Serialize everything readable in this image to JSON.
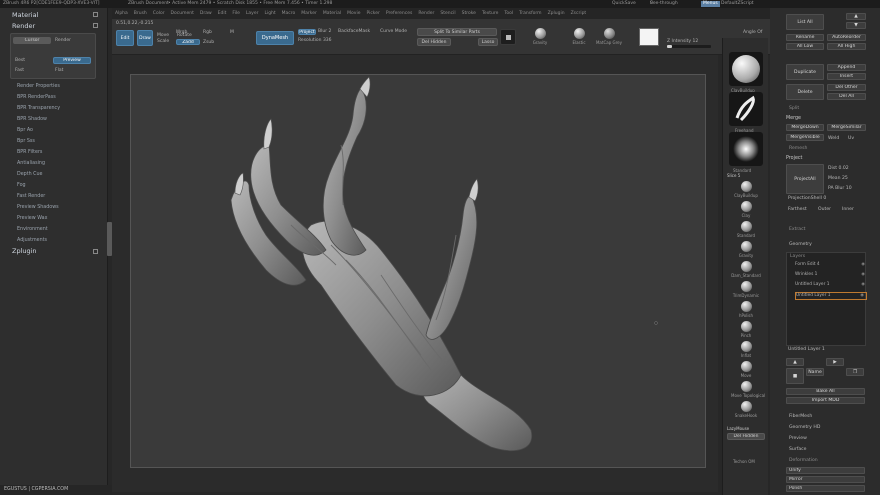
{
  "topbar": {
    "app": "ZBrush 4R6 P2[CDE1FEE9-QDP3-XVE3-VIT]",
    "doc": "ZBrush Document",
    "active_mem": "• Active Mem 2479 • Scratch Disk 1855 • Free Mem 7.456 • Timer 1.298",
    "quicksave": "QuickSave",
    "seethrough": "See-through",
    "seethrough_value": "0",
    "menus": "Menus",
    "script": "DefaultZScript"
  },
  "menus": [
    "Alpha",
    "Brush",
    "Color",
    "Document",
    "Draw",
    "Edit",
    "File",
    "Layer",
    "Light",
    "Macro",
    "Marker",
    "Material",
    "Movie",
    "Picker",
    "Preferences",
    "Render",
    "Stencil",
    "Stroke",
    "Texture",
    "Tool",
    "Transform",
    "Zplugin",
    "Zscript"
  ],
  "shelf": {
    "coords": "0.51,0.22,-0.215",
    "edit": "Edit",
    "draw": "Draw",
    "move": "Move",
    "scale": "Scale",
    "rotate": "Rotate",
    "mrgb": "Mrgb",
    "rgb": "Rgb",
    "m": "M",
    "zadd": "Zadd",
    "zsub": "Zsub",
    "zcut": "Zcut",
    "dynamesh": "DynaMesh",
    "project": "Project",
    "blur": "Blur 2",
    "backface": "BackfaceMask",
    "curve": "Curve Mode",
    "resolution": "Resolution 336",
    "split": "Split To Similar Parts",
    "delhidden": "Del Hidden",
    "lasso": "Lasso",
    "gravity": "Gravity",
    "elastic": "Elastic",
    "matcap": "MatCap Grey",
    "intensity": "Z Intensity 12",
    "intensity_value": 0.12,
    "angle": "Angle Of",
    "colorize": "Colorize"
  },
  "left": {
    "material": "Material",
    "render": "Render",
    "cursor": "Cursor",
    "render_btn": "Render",
    "best": "Best",
    "preview": "Preview",
    "fast": "Fast",
    "flat": "Flat",
    "items": [
      "Render Properties",
      "BPR RenderPass",
      "BPR Transparency",
      "BPR Shadow",
      "Bpr Ao",
      "Bpr Sss",
      "BPR Filters",
      "Antialiasing",
      "Depth Cue",
      "Fog",
      "Fast Render",
      "Preview Shadows",
      "Preview Wax",
      "Environment",
      "Adjustments"
    ],
    "zplugin": "Zplugin"
  },
  "footer": "EGUSTUS | CGPERSIA.COM",
  "tools": {
    "t1": "ClayBuildup",
    "t2": "Freehand",
    "t3": "Standard",
    "s5": "Slice 5",
    "list": [
      "ClayBuildup",
      "Clay",
      "Standard",
      "Gravity",
      "Dam_Standard",
      "TrimDynamic",
      "hPolish",
      "Pinch",
      "Inflat",
      "Move",
      "Move Topological",
      "SnakeHook"
    ],
    "lazymouse": "LazyMouse",
    "delhidden": "Del Hidden",
    "techon": "Techon OM"
  },
  "right": {
    "listall": "List All",
    "rename": "Rename",
    "autoreorder": "AutoReorder",
    "alllow": "All Low",
    "allhigh": "All High",
    "duplicate": "Duplicate",
    "append": "Append",
    "insert": "Insert",
    "delete": "Delete",
    "delother": "Del Other",
    "delall": "Del All",
    "split": "Split",
    "merge": "Merge",
    "mergedown": "MergeDown",
    "mergesimilar": "MergeSimilar",
    "mergevisible": "MergeVisible",
    "weld": "Weld",
    "uv": "Uv",
    "remesh": "Remesh",
    "project": "Project",
    "projectall": "ProjectAll",
    "dist": "Dist 0.02",
    "mean": "Mean 25",
    "pa_blur": "PA Blur 10",
    "projectionshell": "ProjectionShell 0",
    "farthest": "Farthest",
    "outer": "Outer",
    "inner": "Inner",
    "extract": "Extract",
    "geometry": "Geometry",
    "layers": "Layers",
    "layer_rows": [
      "Form Edit 4",
      "Wrinkles 1",
      "Untitled Layer 1",
      "Untitled Layer 1"
    ],
    "untitled_layer": "Untitled Layer 1",
    "name": "Name",
    "bakeall": "Bake All",
    "importmdd": "Import MDD",
    "fibermesh": "FiberMesh",
    "geometryhd": "Geometry HD",
    "preview": "Preview",
    "surface": "Surface",
    "deformation": "Deformation",
    "unify": "Unify",
    "mirror": "Mirror",
    "polish": "Polish"
  }
}
